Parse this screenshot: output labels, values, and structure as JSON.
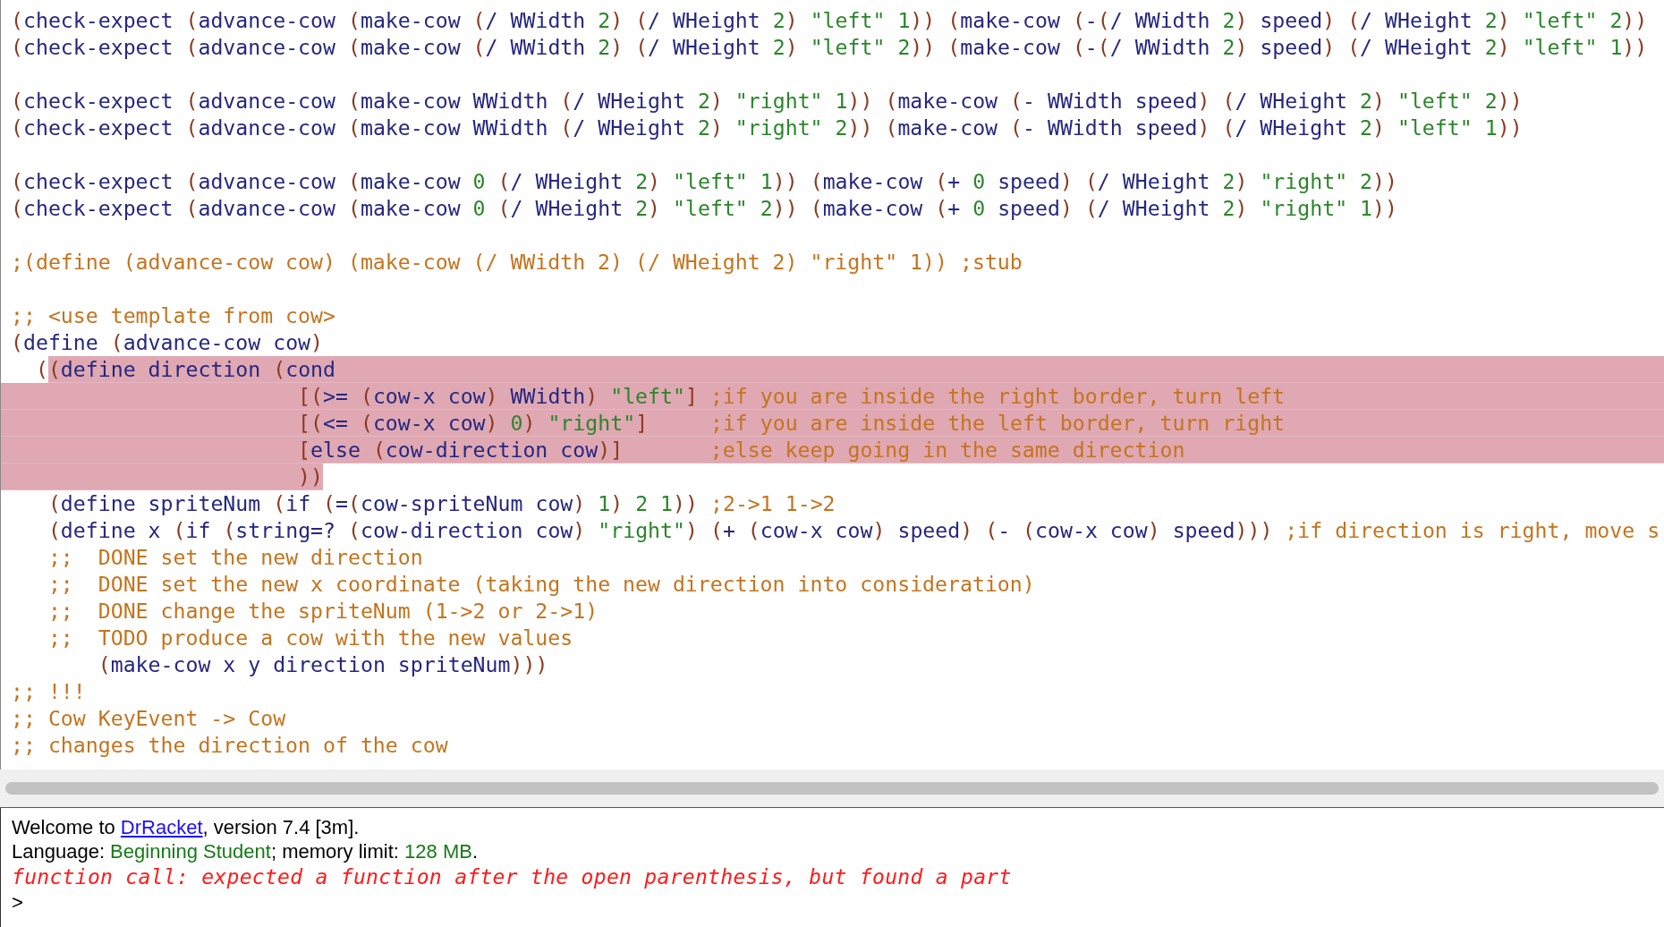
{
  "editor": {
    "lines": [
      {
        "kind": "code",
        "text": "(check-expect (advance-cow (make-cow (/ WWidth 2) (/ WHeight 2) \"left\" 1)) (make-cow (-(/ WWidth 2) speed) (/ WHeight 2) \"left\" 2))",
        "highlighted": false
      },
      {
        "kind": "code",
        "text": "(check-expect (advance-cow (make-cow (/ WWidth 2) (/ WHeight 2) \"left\" 2)) (make-cow (-(/ WWidth 2) speed) (/ WHeight 2) \"left\" 1))",
        "highlighted": false
      },
      {
        "kind": "blank"
      },
      {
        "kind": "code",
        "text": "(check-expect (advance-cow (make-cow WWidth (/ WHeight 2) \"right\" 1)) (make-cow (- WWidth speed) (/ WHeight 2) \"left\" 2))",
        "highlighted": false
      },
      {
        "kind": "code",
        "text": "(check-expect (advance-cow (make-cow WWidth (/ WHeight 2) \"right\" 2)) (make-cow (- WWidth speed) (/ WHeight 2) \"left\" 1))",
        "highlighted": false
      },
      {
        "kind": "blank"
      },
      {
        "kind": "code",
        "text": "(check-expect (advance-cow (make-cow 0 (/ WHeight 2) \"left\" 1)) (make-cow (+ 0 speed) (/ WHeight 2) \"right\" 2))",
        "highlighted": false
      },
      {
        "kind": "code",
        "text": "(check-expect (advance-cow (make-cow 0 (/ WHeight 2) \"left\" 2)) (make-cow (+ 0 speed) (/ WHeight 2) \"right\" 1))",
        "highlighted": false
      },
      {
        "kind": "blank"
      },
      {
        "kind": "code",
        "text": ";(define (advance-cow cow) (make-cow (/ WWidth 2) (/ WHeight 2) \"right\" 1)) ;stub",
        "highlighted": false
      },
      {
        "kind": "blank"
      },
      {
        "kind": "code",
        "text": ";; <use template from cow>",
        "highlighted": false
      },
      {
        "kind": "code",
        "text": "(define (advance-cow cow)",
        "highlighted": false
      },
      {
        "kind": "code",
        "lead": "  (",
        "text": "(define direction (cond",
        "highlighted": true,
        "highlight_to_edge": true
      },
      {
        "kind": "code",
        "text": "                       [(>= (cow-x cow) WWidth) \"left\"] ;if you are inside the right border, turn left",
        "highlighted": true,
        "highlight_to_edge": true
      },
      {
        "kind": "code",
        "text": "                       [(<= (cow-x cow) 0) \"right\"]     ;if you are inside the left border, turn right",
        "highlighted": true,
        "highlight_to_edge": true
      },
      {
        "kind": "code",
        "text": "                       [else (cow-direction cow)]       ;else keep going in the same direction",
        "highlighted": true,
        "highlight_to_edge": true
      },
      {
        "kind": "code",
        "text": "                       ))",
        "highlighted": true,
        "highlight_to_edge": false
      },
      {
        "kind": "code",
        "text": "   (define spriteNum (if (=(cow-spriteNum cow) 1) 2 1)) ;2->1 1->2",
        "highlighted": false
      },
      {
        "kind": "code",
        "text": "   (define x (if (string=? (cow-direction cow) \"right\") (+ (cow-x cow) speed) (- (cow-x cow) speed))) ;if direction is right, move s",
        "highlighted": false
      },
      {
        "kind": "code",
        "text": "   ;;  DONE set the new direction",
        "highlighted": false
      },
      {
        "kind": "code",
        "text": "   ;;  DONE set the new x coordinate (taking the new direction into consideration)",
        "highlighted": false
      },
      {
        "kind": "code",
        "text": "   ;;  DONE change the spriteNum (1->2 or 2->1)",
        "highlighted": false
      },
      {
        "kind": "code",
        "text": "   ;;  TODO produce a cow with the new values",
        "highlighted": false
      },
      {
        "kind": "code",
        "text": "       (make-cow x y direction spriteNum)))",
        "highlighted": false
      },
      {
        "kind": "code",
        "text": ";; !!!",
        "highlighted": false
      },
      {
        "kind": "code",
        "text": ";; Cow KeyEvent -> Cow",
        "highlighted": false
      },
      {
        "kind": "code",
        "text": ";; changes the direction of the cow",
        "highlighted": false
      }
    ]
  },
  "interactions": {
    "welcome": {
      "before": "Welcome to ",
      "link": "DrRacket",
      "after": ", version 7.4 [3m]."
    },
    "language": [
      {
        "kind": "plain",
        "text": "Language: "
      },
      {
        "kind": "value",
        "text": "Beginning Student"
      },
      {
        "kind": "plain",
        "text": "; memory limit: "
      },
      {
        "kind": "value",
        "text": "128 MB"
      },
      {
        "kind": "plain",
        "text": "."
      }
    ],
    "error": "function call: expected a function after the open parenthesis, but found a part",
    "prompt": ">"
  }
}
